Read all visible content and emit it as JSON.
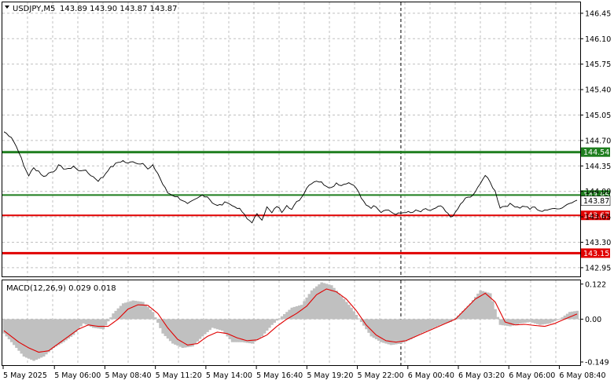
{
  "header": {
    "symbol": "USDJPY,M5",
    "ohlc": "143.89 143.90 143.87 143.87"
  },
  "macd_label": "MACD(12,26,9) 0.029 0.018",
  "colors": {
    "grid": "#c0c0c0",
    "price_line": "#000000",
    "green_level": "#1e7e1e",
    "red_level": "#e00000",
    "histogram": "#c0c0c0",
    "signal": "#e00000"
  },
  "chart_data": [
    {
      "type": "line",
      "title": "USDJPY,M5",
      "ylim": [
        142.83,
        146.6
      ],
      "y_ticks": [
        {
          "value": 146.45,
          "label": "146.45"
        },
        {
          "value": 146.1,
          "label": "146.10"
        },
        {
          "value": 145.75,
          "label": "145.75"
        },
        {
          "value": 145.4,
          "label": "145.40"
        },
        {
          "value": 145.05,
          "label": "145.05"
        },
        {
          "value": 144.7,
          "label": "144.70"
        },
        {
          "value": 144.35,
          "label": "144.35"
        },
        {
          "value": 144.0,
          "label": "144.00"
        },
        {
          "value": 143.65,
          "label": "143.65"
        },
        {
          "value": 143.3,
          "label": "143.30"
        },
        {
          "value": 142.95,
          "label": "142.95"
        }
      ],
      "current_price": {
        "value": 143.87,
        "label": "143.87"
      },
      "x_labels": [
        "5 May 2025",
        "5 May 06:00",
        "5 May 08:40",
        "5 May 11:20",
        "5 May 14:00",
        "5 May 16:40",
        "5 May 19:20",
        "5 May 22:00",
        "6 May 00:40",
        "6 May 03:20",
        "6 May 06:00",
        "6 May 08:40"
      ],
      "x_count": 232,
      "separator_index": 160,
      "price_series": [
        [
          0,
          144.82
        ],
        [
          3,
          144.75
        ],
        [
          6,
          144.55
        ],
        [
          8,
          144.35
        ],
        [
          10,
          144.22
        ],
        [
          12,
          144.32
        ],
        [
          14,
          144.28
        ],
        [
          16,
          144.2
        ],
        [
          18,
          144.25
        ],
        [
          20,
          144.28
        ],
        [
          22,
          144.35
        ],
        [
          24,
          144.32
        ],
        [
          26,
          144.3
        ],
        [
          28,
          144.35
        ],
        [
          30,
          144.28
        ],
        [
          32,
          144.3
        ],
        [
          34,
          144.25
        ],
        [
          36,
          144.2
        ],
        [
          38,
          144.15
        ],
        [
          40,
          144.2
        ],
        [
          42,
          144.3
        ],
        [
          44,
          144.35
        ],
        [
          46,
          144.4
        ],
        [
          48,
          144.42
        ],
        [
          50,
          144.38
        ],
        [
          52,
          144.42
        ],
        [
          54,
          144.38
        ],
        [
          56,
          144.4
        ],
        [
          58,
          144.3
        ],
        [
          60,
          144.35
        ],
        [
          62,
          144.25
        ],
        [
          64,
          144.1
        ],
        [
          66,
          143.98
        ],
        [
          68,
          143.95
        ],
        [
          70,
          143.92
        ],
        [
          72,
          143.88
        ],
        [
          74,
          143.82
        ],
        [
          76,
          143.86
        ],
        [
          78,
          143.9
        ],
        [
          80,
          143.95
        ],
        [
          82,
          143.93
        ],
        [
          84,
          143.85
        ],
        [
          86,
          143.8
        ],
        [
          88,
          143.82
        ],
        [
          90,
          143.86
        ],
        [
          92,
          143.8
        ],
        [
          94,
          143.78
        ],
        [
          96,
          143.72
        ],
        [
          98,
          143.62
        ],
        [
          100,
          143.58
        ],
        [
          102,
          143.68
        ],
        [
          104,
          143.62
        ],
        [
          106,
          143.78
        ],
        [
          108,
          143.7
        ],
        [
          110,
          143.8
        ],
        [
          112,
          143.72
        ],
        [
          114,
          143.82
        ],
        [
          116,
          143.75
        ],
        [
          118,
          143.85
        ],
        [
          120,
          143.92
        ],
        [
          122,
          144.05
        ],
        [
          124,
          144.12
        ],
        [
          126,
          144.15
        ],
        [
          128,
          144.12
        ],
        [
          130,
          144.08
        ],
        [
          132,
          144.05
        ],
        [
          134,
          144.12
        ],
        [
          136,
          144.08
        ],
        [
          138,
          144.12
        ],
        [
          140,
          144.1
        ],
        [
          142,
          144.05
        ],
        [
          144,
          143.9
        ],
        [
          146,
          143.82
        ],
        [
          148,
          143.78
        ],
        [
          150,
          143.8
        ],
        [
          152,
          143.72
        ],
        [
          154,
          143.76
        ],
        [
          156,
          143.72
        ],
        [
          158,
          143.68
        ],
        [
          160,
          143.7
        ],
        [
          162,
          143.72
        ],
        [
          164,
          143.7
        ],
        [
          166,
          143.73
        ],
        [
          168,
          143.72
        ],
        [
          170,
          143.75
        ],
        [
          172,
          143.74
        ],
        [
          174,
          143.76
        ],
        [
          176,
          143.8
        ],
        [
          178,
          143.72
        ],
        [
          180,
          143.65
        ],
        [
          182,
          143.7
        ],
        [
          184,
          143.82
        ],
        [
          186,
          143.9
        ],
        [
          188,
          143.92
        ],
        [
          190,
          143.98
        ],
        [
          192,
          144.12
        ],
        [
          194,
          144.22
        ],
        [
          196,
          144.12
        ],
        [
          198,
          144.0
        ],
        [
          200,
          143.78
        ],
        [
          202,
          143.8
        ],
        [
          204,
          143.82
        ],
        [
          206,
          143.8
        ],
        [
          208,
          143.78
        ],
        [
          210,
          143.8
        ],
        [
          212,
          143.76
        ],
        [
          214,
          143.78
        ],
        [
          216,
          143.72
        ],
        [
          218,
          143.75
        ],
        [
          220,
          143.74
        ],
        [
          222,
          143.78
        ],
        [
          224,
          143.76
        ],
        [
          226,
          143.8
        ],
        [
          228,
          143.84
        ],
        [
          230,
          143.88
        ],
        [
          231,
          143.87
        ]
      ],
      "levels": [
        {
          "value": 144.54,
          "label": "144.54",
          "color": "#1e7e1e",
          "width": 3
        },
        {
          "value": 143.95,
          "label": "143.95",
          "color": "#1e7e1e",
          "width": 2
        },
        {
          "value": 143.67,
          "label": "143.67",
          "color": "#e00000",
          "width": 2
        },
        {
          "value": 143.15,
          "label": "143.15",
          "color": "#e00000",
          "width": 3
        }
      ]
    },
    {
      "type": "bar",
      "title": "MACD(12,26,9)",
      "ylim": [
        -0.16,
        0.135
      ],
      "y_ticks": [
        {
          "value": 0.122,
          "label": "0.122"
        },
        {
          "value": 0.0,
          "label": "0.00"
        },
        {
          "value": -0.149,
          "label": "-0.149"
        }
      ],
      "histogram_key": [
        [
          0,
          -0.05
        ],
        [
          4,
          -0.09
        ],
        [
          8,
          -0.13
        ],
        [
          12,
          -0.145
        ],
        [
          16,
          -0.13
        ],
        [
          20,
          -0.1
        ],
        [
          24,
          -0.08
        ],
        [
          28,
          -0.055
        ],
        [
          32,
          -0.015
        ],
        [
          36,
          -0.03
        ],
        [
          40,
          -0.035
        ],
        [
          44,
          0.02
        ],
        [
          48,
          0.055
        ],
        [
          52,
          0.065
        ],
        [
          56,
          0.06
        ],
        [
          60,
          0.025
        ],
        [
          64,
          -0.05
        ],
        [
          68,
          -0.085
        ],
        [
          72,
          -0.1
        ],
        [
          76,
          -0.095
        ],
        [
          80,
          -0.06
        ],
        [
          84,
          -0.03
        ],
        [
          88,
          -0.04
        ],
        [
          92,
          -0.08
        ],
        [
          96,
          -0.08
        ],
        [
          100,
          -0.085
        ],
        [
          104,
          -0.06
        ],
        [
          108,
          -0.02
        ],
        [
          112,
          0.01
        ],
        [
          116,
          0.04
        ],
        [
          120,
          0.05
        ],
        [
          124,
          0.1
        ],
        [
          128,
          0.128
        ],
        [
          132,
          0.118
        ],
        [
          136,
          0.08
        ],
        [
          140,
          0.04
        ],
        [
          144,
          -0.01
        ],
        [
          148,
          -0.06
        ],
        [
          152,
          -0.08
        ],
        [
          156,
          -0.09
        ],
        [
          160,
          -0.085
        ],
        [
          164,
          -0.07
        ],
        [
          168,
          -0.05
        ],
        [
          172,
          -0.035
        ],
        [
          176,
          -0.02
        ],
        [
          180,
          -0.01
        ],
        [
          184,
          0.02
        ],
        [
          188,
          0.055
        ],
        [
          192,
          0.1
        ],
        [
          196,
          0.09
        ],
        [
          200,
          -0.02
        ],
        [
          204,
          -0.025
        ],
        [
          208,
          -0.015
        ],
        [
          212,
          -0.01
        ],
        [
          216,
          -0.02
        ],
        [
          220,
          -0.015
        ],
        [
          224,
          0.0
        ],
        [
          228,
          0.025
        ],
        [
          231,
          0.029
        ]
      ],
      "signal_key": [
        [
          0,
          -0.04
        ],
        [
          6,
          -0.08
        ],
        [
          10,
          -0.1
        ],
        [
          14,
          -0.115
        ],
        [
          18,
          -0.11
        ],
        [
          22,
          -0.085
        ],
        [
          26,
          -0.06
        ],
        [
          30,
          -0.035
        ],
        [
          34,
          -0.02
        ],
        [
          38,
          -0.025
        ],
        [
          42,
          -0.025
        ],
        [
          46,
          0.0
        ],
        [
          50,
          0.035
        ],
        [
          54,
          0.05
        ],
        [
          58,
          0.048
        ],
        [
          62,
          0.02
        ],
        [
          66,
          -0.03
        ],
        [
          70,
          -0.07
        ],
        [
          74,
          -0.09
        ],
        [
          78,
          -0.085
        ],
        [
          82,
          -0.06
        ],
        [
          86,
          -0.045
        ],
        [
          90,
          -0.05
        ],
        [
          94,
          -0.065
        ],
        [
          98,
          -0.075
        ],
        [
          102,
          -0.072
        ],
        [
          106,
          -0.055
        ],
        [
          110,
          -0.025
        ],
        [
          114,
          0.0
        ],
        [
          118,
          0.02
        ],
        [
          122,
          0.045
        ],
        [
          126,
          0.085
        ],
        [
          130,
          0.105
        ],
        [
          134,
          0.095
        ],
        [
          138,
          0.07
        ],
        [
          142,
          0.03
        ],
        [
          146,
          -0.02
        ],
        [
          150,
          -0.055
        ],
        [
          154,
          -0.075
        ],
        [
          158,
          -0.08
        ],
        [
          162,
          -0.075
        ],
        [
          166,
          -0.06
        ],
        [
          170,
          -0.045
        ],
        [
          174,
          -0.03
        ],
        [
          178,
          -0.015
        ],
        [
          182,
          0.0
        ],
        [
          186,
          0.035
        ],
        [
          190,
          0.07
        ],
        [
          194,
          0.09
        ],
        [
          198,
          0.06
        ],
        [
          202,
          -0.01
        ],
        [
          206,
          -0.02
        ],
        [
          210,
          -0.018
        ],
        [
          214,
          -0.022
        ],
        [
          218,
          -0.025
        ],
        [
          222,
          -0.015
        ],
        [
          226,
          0.0
        ],
        [
          231,
          0.018
        ]
      ]
    }
  ]
}
